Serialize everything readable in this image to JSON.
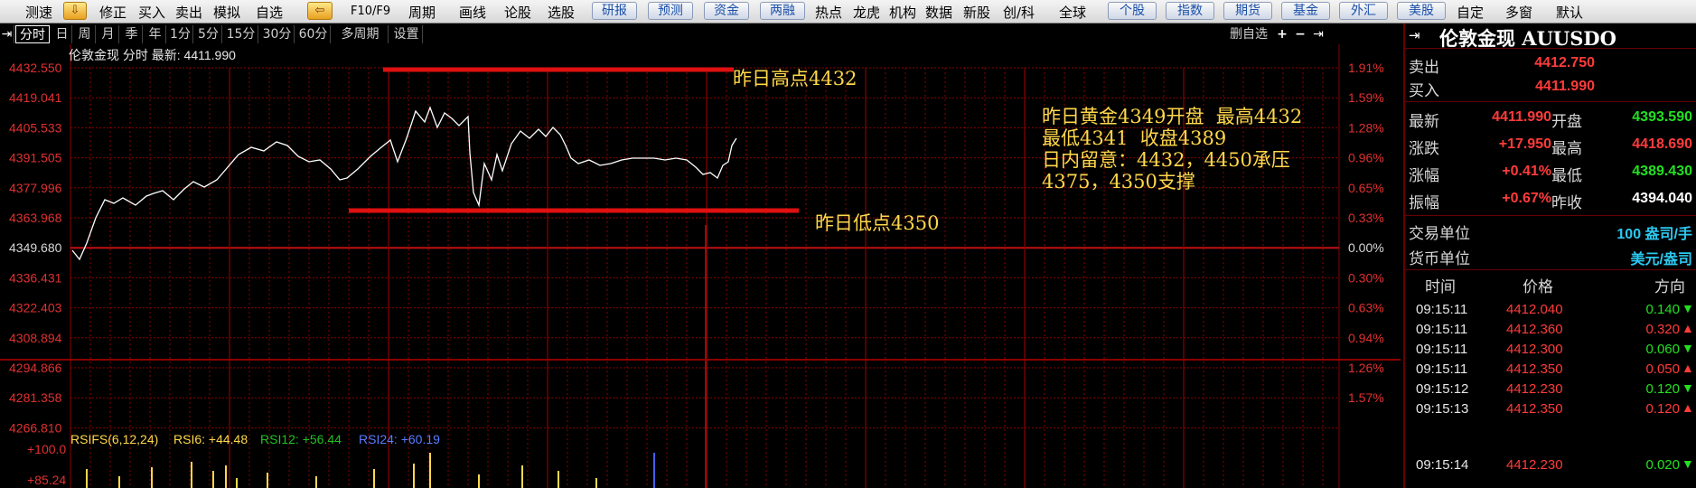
{
  "toolbar": {
    "items": [
      "测速",
      "修正",
      "买入",
      "卖出",
      "模拟",
      "自选",
      "F10/F9",
      "周期",
      "画线",
      "论股",
      "选股",
      "热点",
      "龙虎",
      "机构",
      "数据",
      "新股",
      "创/科",
      "全球",
      "自定",
      "多窗",
      "默认"
    ],
    "buttons": [
      "研报",
      "预测",
      "资金",
      "两融",
      "个股",
      "指数",
      "期货",
      "基金",
      "外汇",
      "美股"
    ]
  },
  "periods": [
    "分时",
    "日",
    "周",
    "月",
    "季",
    "年",
    "1分",
    "5分",
    "15分",
    "30分",
    "60分",
    "多周期",
    "设置"
  ],
  "chart_tools": {
    "label": "删自选",
    "glyphs": [
      "+",
      "−",
      "⇥"
    ]
  },
  "chart": {
    "header": "伦敦金现 分时 最新: 4411.990",
    "left_ticks": [
      "4432.550",
      "4419.041",
      "4405.533",
      "4391.505",
      "4377.996",
      "4363.968",
      "4349.680",
      "4336.431",
      "4322.403",
      "4308.894",
      "4294.866",
      "4281.358",
      "4266.810"
    ],
    "right_ticks": [
      "1.91%",
      "1.59%",
      "1.28%",
      "0.96%",
      "0.65%",
      "0.33%",
      "0.00%",
      "0.30%",
      "0.63%",
      "0.94%",
      "1.26%",
      "1.57%"
    ],
    "annotations": {
      "high": "昨日高点4432",
      "low": "昨日低点4350",
      "note": "昨日黄金4349开盘  最高4432\n最低4341  收盘4389\n日内留意：4432，4450承压\n4375，4350支撑"
    },
    "rsi": {
      "label": "RSIFS(6,12,24)",
      "rsi6": "RSI6: +44.48",
      "rsi12": "RSI12: +56.44",
      "rsi24": "RSI24: +60.19",
      "top": "+100.0",
      "mid": "+85.24"
    },
    "colors": {
      "price": "#ffffff",
      "grid": "#8b0000",
      "annotation": "#ffd84a",
      "level": "#e01010"
    }
  },
  "panel": {
    "title": "伦敦金现 AUUSDO",
    "sell": {
      "label": "卖出",
      "value": "4412.750"
    },
    "buy": {
      "label": "买入",
      "value": "4411.990"
    },
    "stats": [
      {
        "l1": "最新",
        "v1": "4411.990",
        "l2": "开盘",
        "v2": "4393.590"
      },
      {
        "l1": "涨跌",
        "v1": "+17.950",
        "l2": "最高",
        "v2": "4418.690"
      },
      {
        "l1": "涨幅",
        "v1": "+0.41%",
        "l2": "最低",
        "v2": "4389.430"
      },
      {
        "l1": "振幅",
        "v1": "+0.67%",
        "l2": "昨收",
        "v2": "4394.040"
      }
    ],
    "unit1": {
      "label": "交易单位",
      "value": "100 盎司/手"
    },
    "unit2": {
      "label": "货币单位",
      "value": "美元/盎司"
    },
    "tick_headers": [
      "时间",
      "价格",
      "方向"
    ],
    "ticks": [
      {
        "time": "09:15:11",
        "price": "4412.040",
        "vol": "0.140",
        "dir": "down"
      },
      {
        "time": "09:15:11",
        "price": "4412.360",
        "vol": "0.320",
        "dir": "up"
      },
      {
        "time": "09:15:11",
        "price": "4412.300",
        "vol": "0.060",
        "dir": "down"
      },
      {
        "time": "09:15:11",
        "price": "4412.350",
        "vol": "0.050",
        "dir": "up"
      },
      {
        "time": "09:15:12",
        "price": "4412.230",
        "vol": "0.120",
        "dir": "down"
      },
      {
        "time": "09:15:13",
        "price": "4412.350",
        "vol": "0.120",
        "dir": "up"
      },
      {
        "time": "09:15:14",
        "price": "4412.230",
        "vol": "0.020",
        "dir": "down"
      }
    ]
  }
}
